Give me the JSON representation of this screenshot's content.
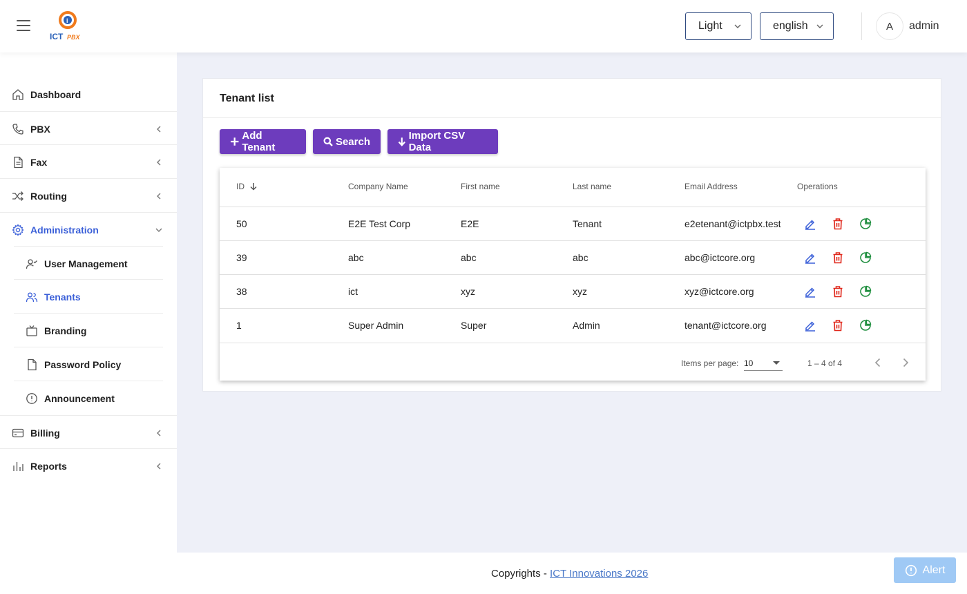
{
  "header": {
    "menu_icon": "hamburger-icon",
    "logo_text": "ICTPBX",
    "theme": "Light",
    "language": "english",
    "avatar_initial": "A",
    "username": "admin"
  },
  "sidebar": {
    "items": [
      {
        "label": "Dashboard",
        "icon": "home-icon"
      },
      {
        "label": "PBX",
        "icon": "phone-icon"
      },
      {
        "label": "Fax",
        "icon": "document-icon"
      },
      {
        "label": "Routing",
        "icon": "shuffle-icon"
      },
      {
        "label": "Administration",
        "icon": "gear-icon"
      },
      {
        "label": "Billing",
        "icon": "credit-card-icon"
      },
      {
        "label": "Reports",
        "icon": "bar-chart-icon"
      }
    ],
    "admin_sub_items": [
      {
        "label": "User Management",
        "icon": "user-check-icon"
      },
      {
        "label": "Tenants",
        "icon": "users-icon"
      },
      {
        "label": "Branding",
        "icon": "tv-icon"
      },
      {
        "label": "Password Policy",
        "icon": "file-icon"
      },
      {
        "label": "Announcement",
        "icon": "alert-circle-icon"
      }
    ],
    "active_item": "Administration",
    "active_sub_item": "Tenants"
  },
  "main": {
    "title": "Tenant list",
    "buttons": {
      "add": "Add Tenant",
      "search": "Search",
      "import": "Import CSV Data"
    },
    "table": {
      "columns": [
        "ID",
        "Company Name",
        "First name",
        "Last name",
        "Email Address",
        "Operations"
      ],
      "sort_column": "ID",
      "sort_direction": "descending",
      "rows": [
        {
          "id": "50",
          "company": "E2E Test Corp",
          "first": "E2E",
          "last": "Tenant",
          "email": "e2etenant@ictpbx.test"
        },
        {
          "id": "39",
          "company": "abc",
          "first": "abc",
          "last": "abc",
          "email": "abc@ictcore.org"
        },
        {
          "id": "38",
          "company": "ict",
          "first": "xyz",
          "last": "xyz",
          "email": "xyz@ictcore.org"
        },
        {
          "id": "1",
          "company": "Super Admin",
          "first": "Super",
          "last": "Admin",
          "email": "tenant@ictcore.org"
        }
      ],
      "operations_icons": [
        "edit-icon",
        "trash-icon",
        "pie-chart-icon"
      ]
    },
    "paginator": {
      "items_per_page_label": "Items per page:",
      "items_per_page": "10",
      "range": "1 – 4 of 4"
    }
  },
  "footer": {
    "prefix": "Copyrights - ",
    "link": "ICT Innovations 2026"
  },
  "alert_button": "Alert",
  "colors": {
    "primary_button": "#6d3cbd",
    "active_nav": "#3a5fd8",
    "edit": "#3a5fd8",
    "delete": "#e0281c",
    "stats": "#1e8e3e",
    "alert": "#9fc9f5"
  }
}
